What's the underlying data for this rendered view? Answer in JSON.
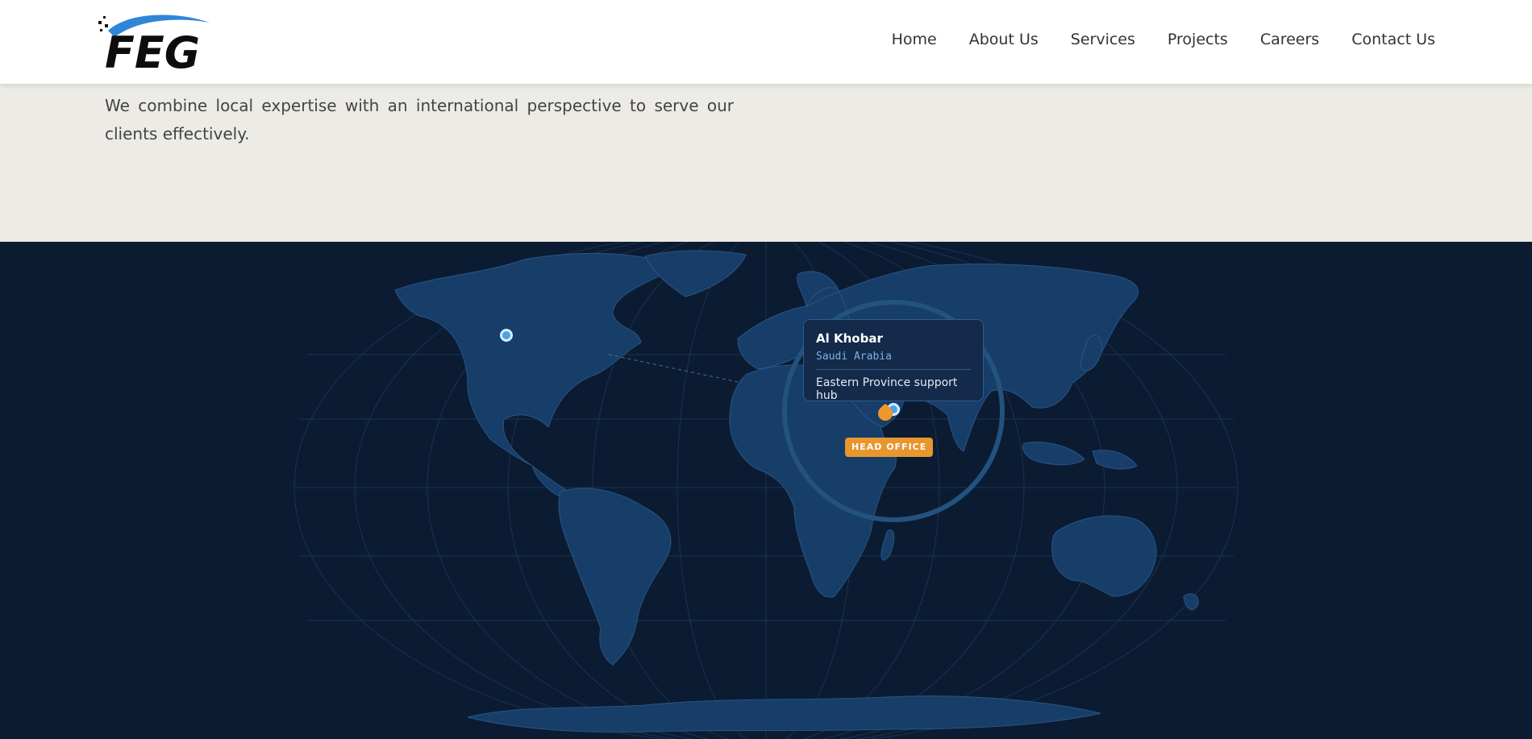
{
  "brand": {
    "logo_text": "FEG",
    "accent": "#2f86d6"
  },
  "nav": {
    "items": [
      "Home",
      "About Us",
      "Services",
      "Projects",
      "Careers",
      "Contact Us"
    ]
  },
  "intro": {
    "text": "We combine local expertise with an international perspective to serve our clients effectively."
  },
  "map": {
    "background": "#0b1c32",
    "land_color": "#173d69",
    "tooltip": {
      "city": "Al Khobar",
      "country": "Saudi Arabia",
      "description": "Eastern Province support hub"
    },
    "badge": "HEAD OFFICE",
    "badge_color": "#e8962e"
  }
}
